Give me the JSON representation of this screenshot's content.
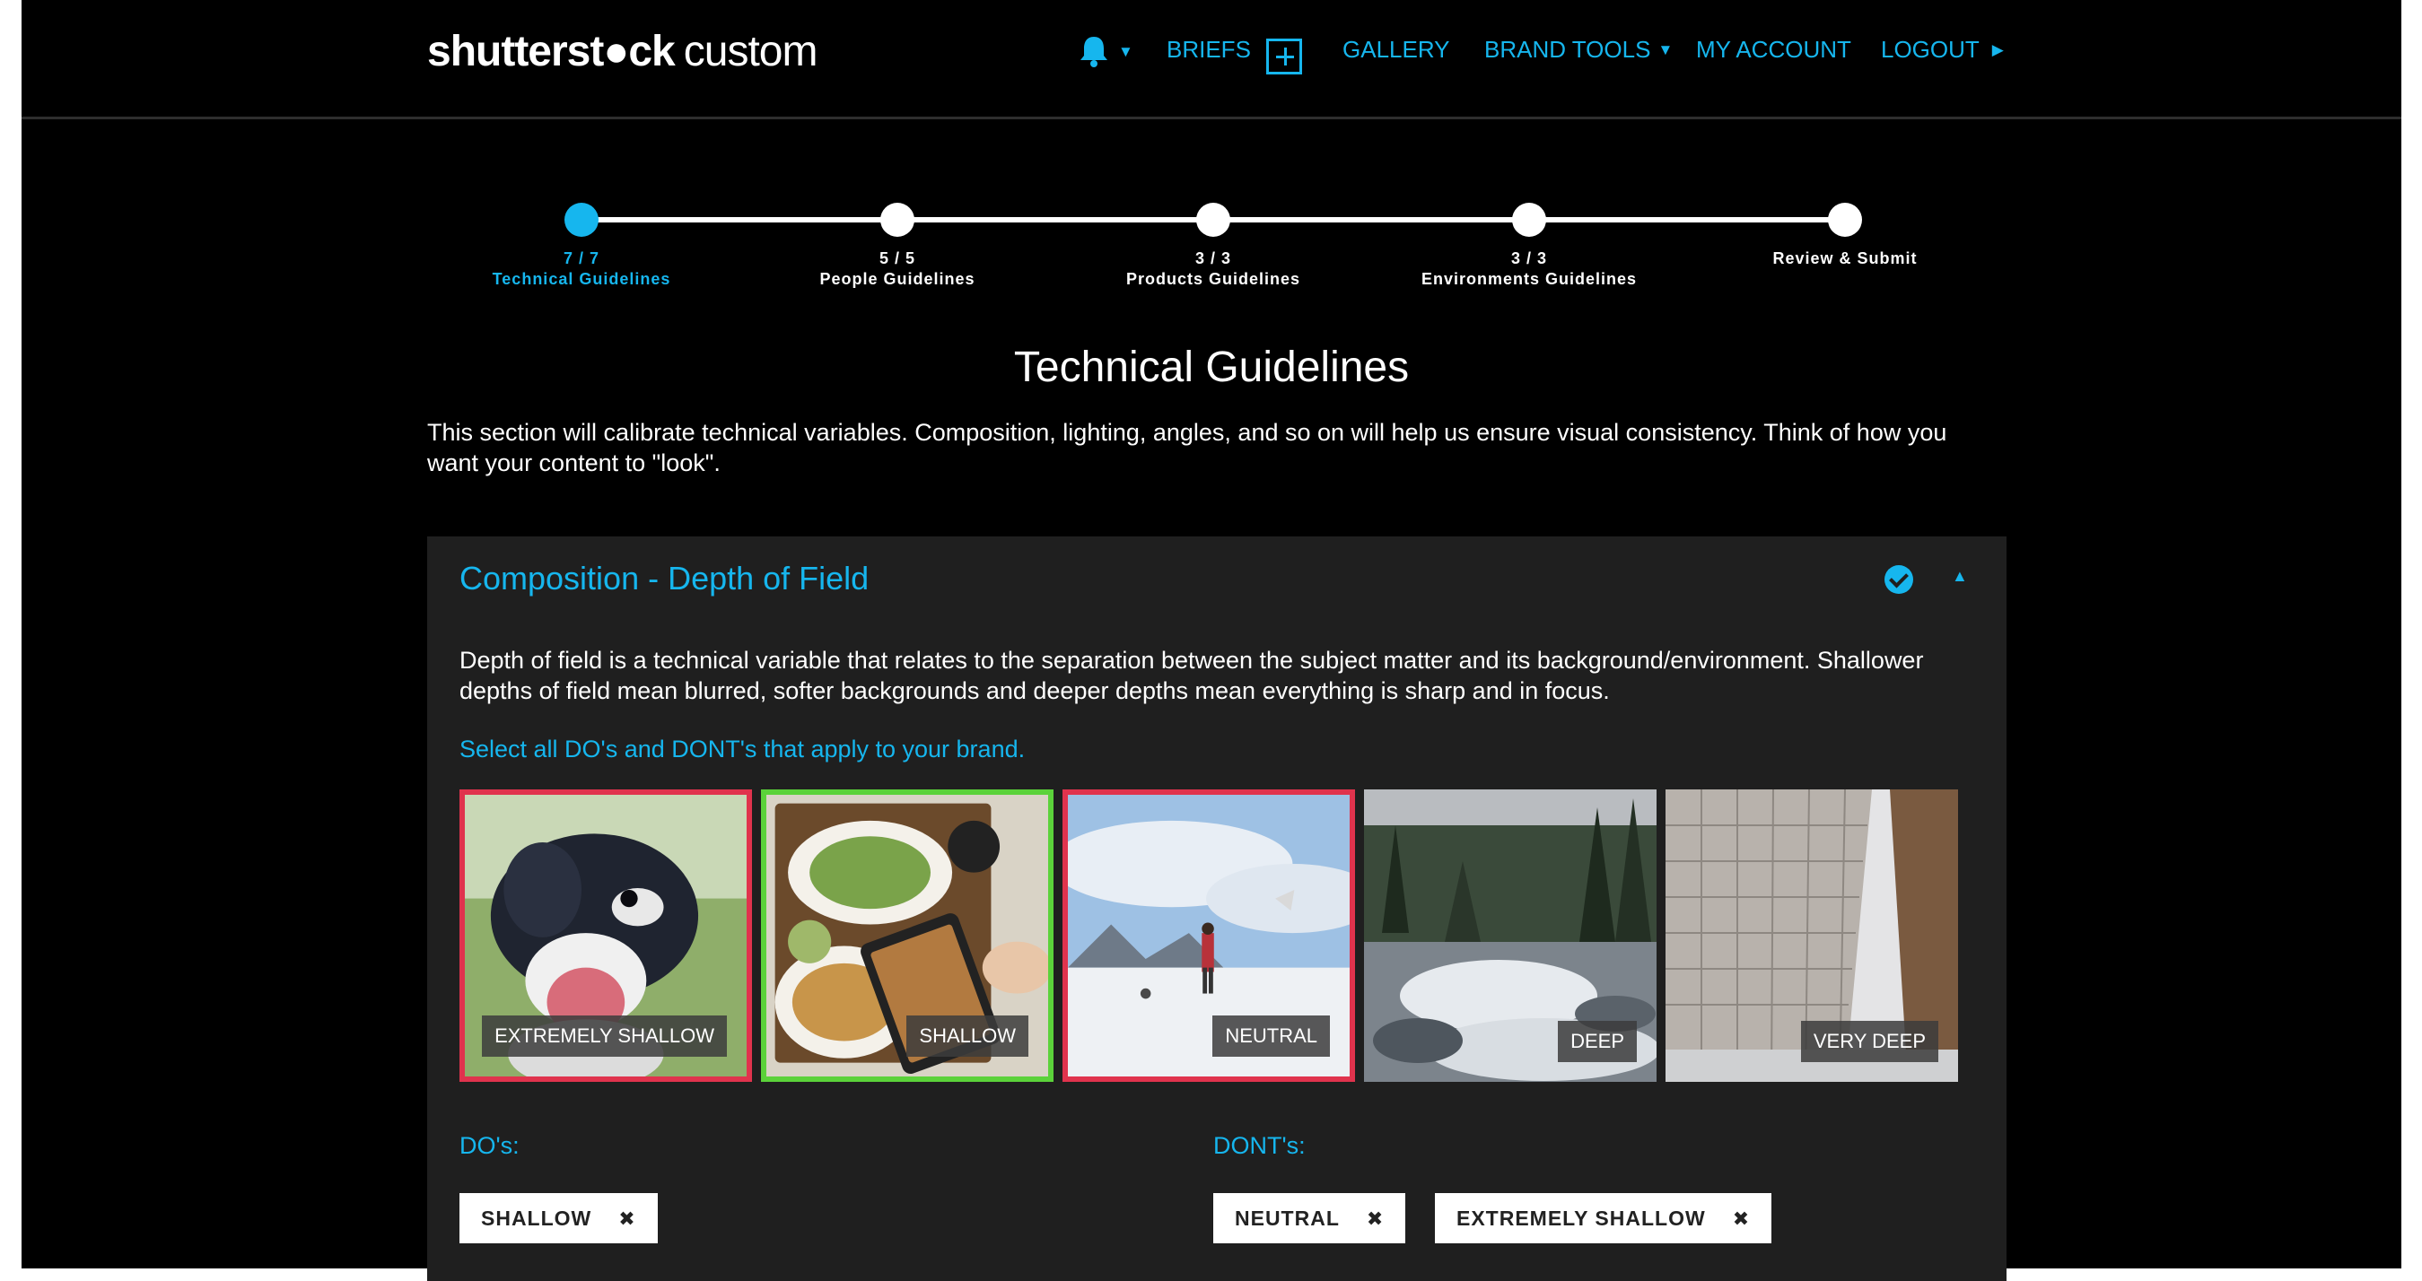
{
  "header": {
    "logo_brand": "shutterst●ck",
    "logo_suffix": "custom",
    "nav": {
      "briefs": "BRIEFS",
      "gallery": "GALLERY",
      "brand_tools": "BRAND TOOLS",
      "my_account": "MY ACCOUNT",
      "logout": "LOGOUT"
    },
    "icons": [
      "bell-icon",
      "plus-box-icon",
      "caret-down-icon",
      "caret-right-icon"
    ]
  },
  "stepper": {
    "steps": [
      {
        "count": "7 / 7",
        "label": "Technical Guidelines",
        "active": true
      },
      {
        "count": "5 / 5",
        "label": "People Guidelines",
        "active": false
      },
      {
        "count": "3 / 3",
        "label": "Products Guidelines",
        "active": false
      },
      {
        "count": "3 / 3",
        "label": "Environments Guidelines",
        "active": false
      },
      {
        "count": "",
        "label": "Review & Submit",
        "active": false
      }
    ]
  },
  "page": {
    "title": "Technical Guidelines",
    "intro": "This section will calibrate technical variables. Composition, lighting, angles, and so on will help us ensure visual consistency. Think of how you want your content to \"look\"."
  },
  "section": {
    "title": "Composition - Depth of Field",
    "description": "Depth of field is a technical variable that relates to the separation between the subject matter and its background/environment. Shallower depths of field mean blurred, softer backgrounds and deeper depths mean everything is sharp and in focus.",
    "instruction": "Select all DO's and DONT's that apply to your brand.",
    "options": [
      {
        "label": "EXTREMELY SHALLOW",
        "state": "dont"
      },
      {
        "label": "SHALLOW",
        "state": "do"
      },
      {
        "label": "NEUTRAL",
        "state": "dont"
      },
      {
        "label": "DEEP",
        "state": "none"
      },
      {
        "label": "VERY DEEP",
        "state": "none"
      }
    ],
    "dos_label": "DO's:",
    "donts_label": "DONT's:",
    "dos": [
      "SHALLOW"
    ],
    "donts": [
      "NEUTRAL",
      "EXTREMELY SHALLOW"
    ],
    "remove_glyph": "✖"
  },
  "colors": {
    "accent": "#16b6ee",
    "background": "#000000",
    "card": "#1f1f1f",
    "dont_border": "#e0334d",
    "do_border": "#5bd23a"
  }
}
